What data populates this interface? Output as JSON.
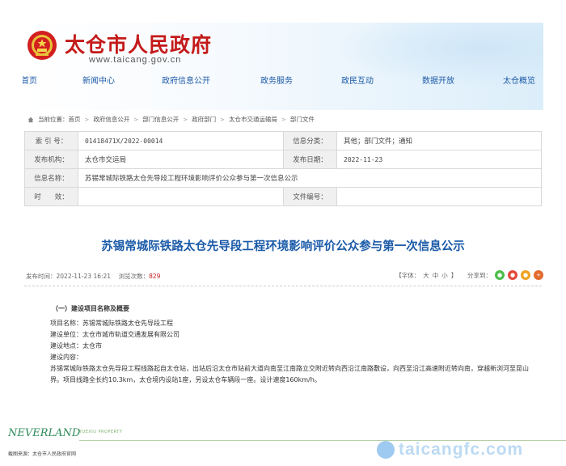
{
  "site": {
    "title": "太仓市人民政府",
    "url": "www.taicang.gov.cn"
  },
  "nav": [
    "首页",
    "新闻中心",
    "政府信息公开",
    "政务服务",
    "政民互动",
    "数据开放",
    "太仓概览"
  ],
  "breadcrumb": [
    "当前位置：首页",
    "政府信息公开",
    "部门信息公开",
    "政府部门",
    "太仓市交通运输局",
    "部门文件"
  ],
  "info": {
    "index_label": "索 引 号：",
    "index_value": "01418471X/2022-00014",
    "category_label": "信息分类：",
    "category_value": "其他；部门文件；通知",
    "publisher_label": "发布机构：",
    "publisher_value": "太仓市交运局",
    "date_label": "发布日期：",
    "date_value": "2022-11-23",
    "name_label": "信息名称：",
    "name_value": "苏锡常城际铁路太仓先导段工程环境影响评价公众参与第一次信息公示",
    "validity_label": "时　　效：",
    "validity_value": "",
    "docno_label": "文件编号：",
    "docno_value": ""
  },
  "article": {
    "title": "苏锡常城际铁路太仓先导段工程环境影响评价公众参与第一次信息公示",
    "published": "发布时间：2022-11-23 16:21",
    "views_label": "浏览次数：",
    "views": "829",
    "font_label": "【字体：",
    "font_large": "大",
    "font_medium": "中",
    "font_small": "小",
    "font_end": "】",
    "share_label": "分享到："
  },
  "body": {
    "section": "（一）建设项目名称及概要",
    "lines": [
      "项目名称：苏锡常城际铁路太仓先导段工程",
      "建设单位：太仓市城市轨道交通发展有限公司",
      "建设地点：太仓市",
      "建设内容："
    ],
    "description": "苏锡常城际铁路太仓先导段工程线路起自太仓站，出站后沿太仓市站前大道向南至江南路立交附近转向西沿江南路敷设，向西至沿江高速附近转向南，穿越新浏河至昆山界。项目线路全长约10.3km，太仓境内设站1座，另设太仓车辆段一座。设计速度160km/h。"
  },
  "footer": {
    "brand": "NEVERLAND",
    "brand_sub": "YUEXIU PROPERTY",
    "source": "截图来源：太仓市人民政府官网",
    "watermark": "taicangfc.com"
  },
  "colors": {
    "title_red": "#c41a1a",
    "link_blue": "#1c5aa6",
    "article_blue": "#1a5aa8",
    "views_red": "#c41a1a"
  },
  "icons": [
    "national-emblem-icon",
    "home-icon",
    "wechat-icon",
    "weibo-icon",
    "qq-icon",
    "more-icon",
    "watermark-logo-icon"
  ]
}
